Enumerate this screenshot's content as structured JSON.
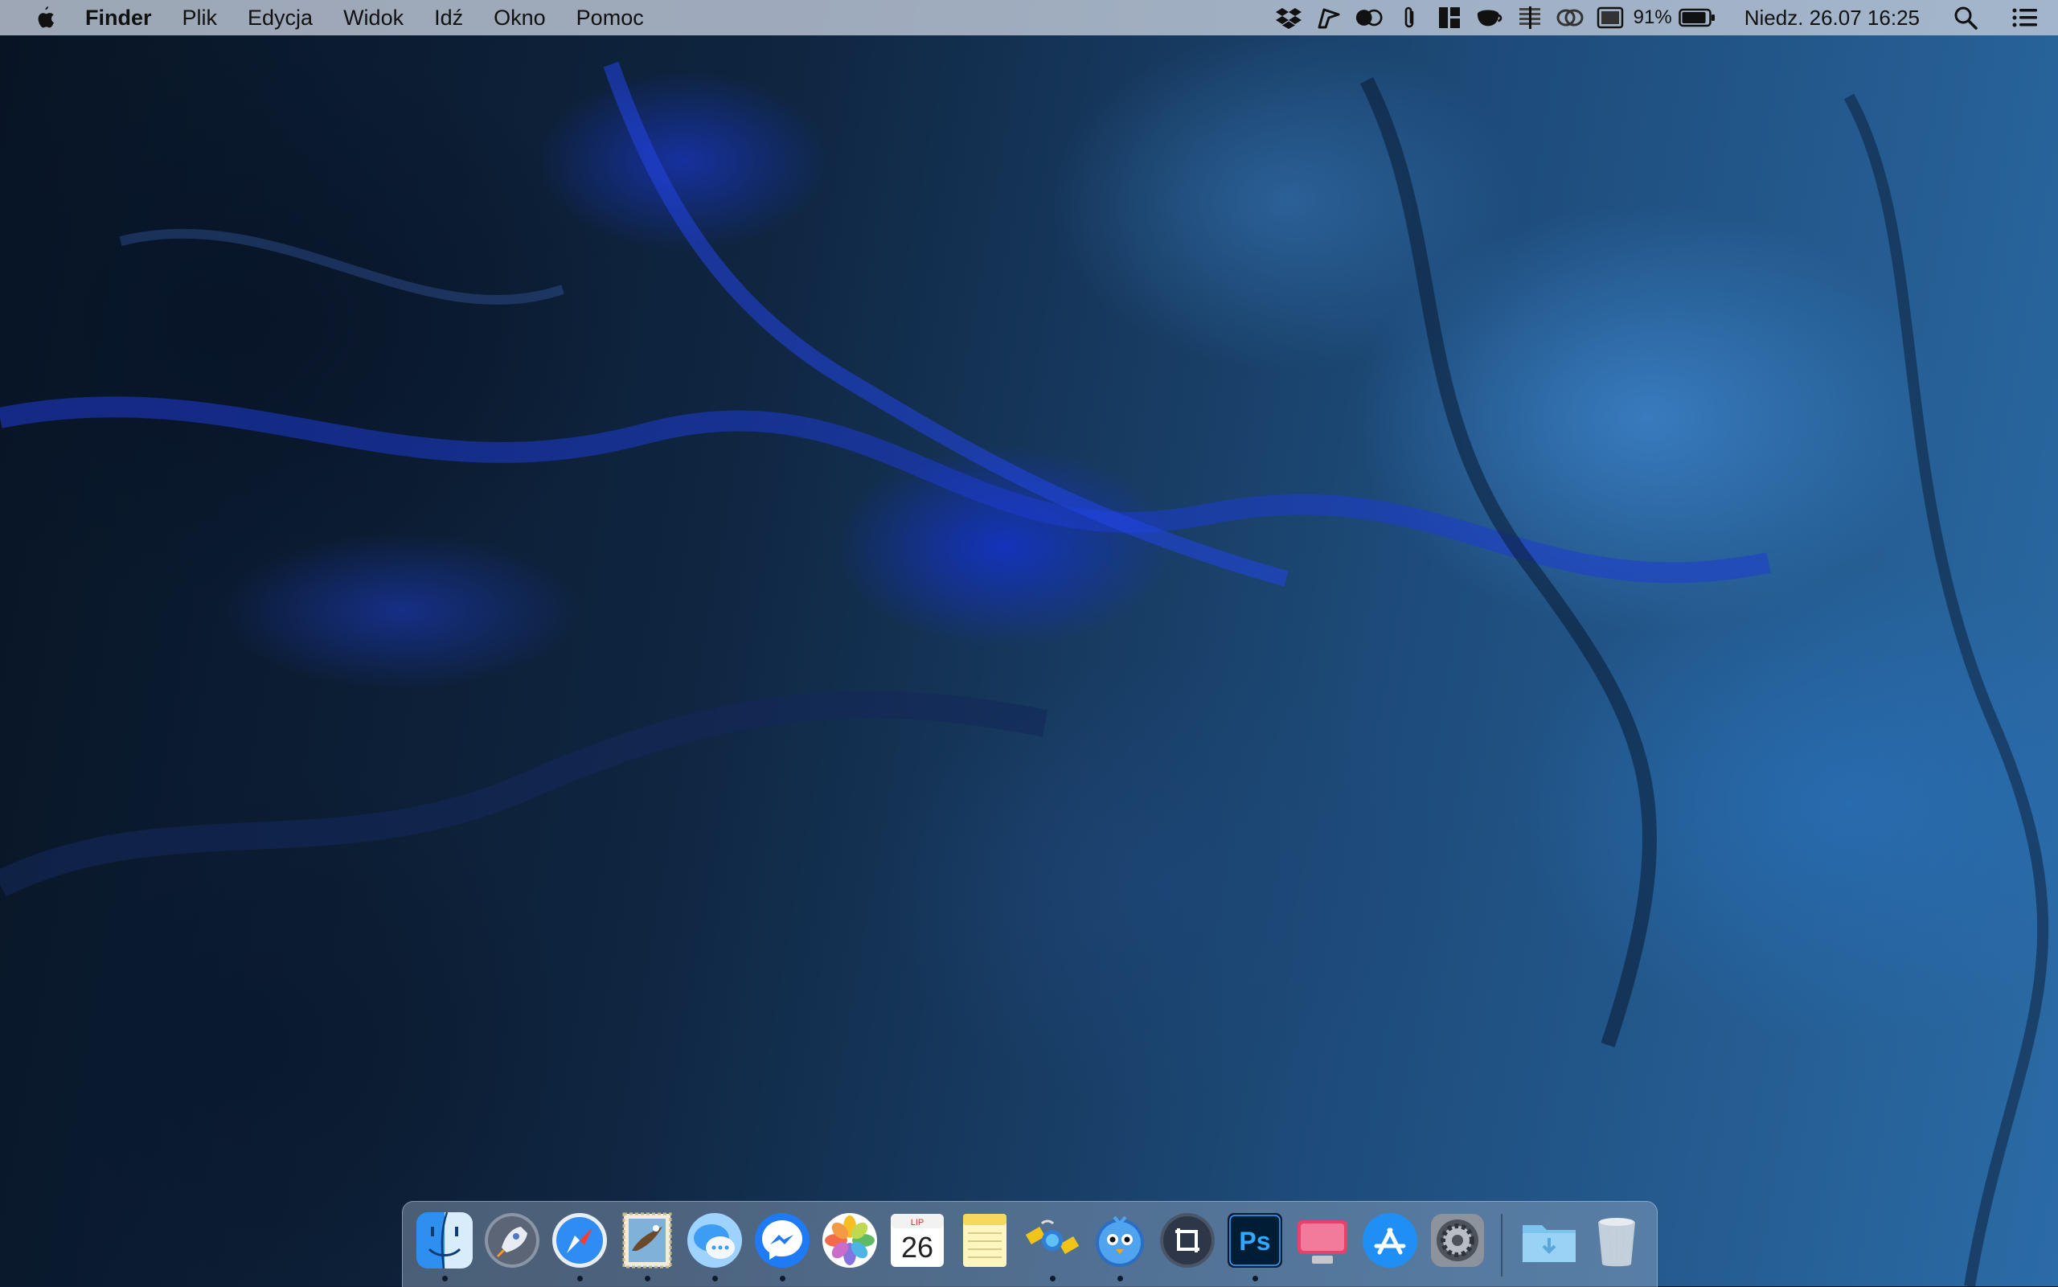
{
  "menubar": {
    "apple_icon": "apple-logo-icon",
    "items": [
      "Finder",
      "Plik",
      "Edycja",
      "Widok",
      "Idź",
      "Okno",
      "Pomoc"
    ],
    "status_icons": [
      "dropbox-icon",
      "flag-icon",
      "toggle-icon",
      "paperclip-icon",
      "layout-icon",
      "cup-icon",
      "stats-icon",
      "link-icon",
      "display-icon"
    ],
    "battery_percent": "91%",
    "battery_level": 0.91,
    "datetime": "Niedz. 26.07  16:25",
    "search_icon": "spotlight-search-icon",
    "control_icon": "notification-list-icon"
  },
  "dock": {
    "apps": [
      {
        "name": "Finder",
        "icon": "finder-icon",
        "running": true
      },
      {
        "name": "Launchpad",
        "icon": "launchpad-icon",
        "running": false
      },
      {
        "name": "Safari",
        "icon": "safari-icon",
        "running": true
      },
      {
        "name": "Mail",
        "icon": "mail-stamp-icon",
        "running": true
      },
      {
        "name": "Messages",
        "icon": "messages-icon",
        "running": true
      },
      {
        "name": "Messenger",
        "icon": "messenger-icon",
        "running": true
      },
      {
        "name": "Photos",
        "icon": "photos-icon",
        "running": false
      },
      {
        "name": "Calendar",
        "icon": "calendar-icon",
        "running": false,
        "month": "LIP",
        "day": "26"
      },
      {
        "name": "Notes",
        "icon": "notes-icon",
        "running": false
      },
      {
        "name": "Satellite",
        "icon": "satellite-icon",
        "running": true
      },
      {
        "name": "Tweetbot",
        "icon": "tweetbot-icon",
        "running": true
      },
      {
        "name": "Screen Capture",
        "icon": "crop-icon",
        "running": false
      },
      {
        "name": "Photoshop",
        "icon": "photoshop-icon",
        "running": true,
        "label": "Ps"
      },
      {
        "name": "CleanMyMac",
        "icon": "cleanmymac-icon",
        "running": false
      },
      {
        "name": "App Store",
        "icon": "appstore-icon",
        "running": false
      },
      {
        "name": "System Preferences",
        "icon": "system-preferences-icon",
        "running": false
      },
      {
        "name": "Downloads",
        "icon": "downloads-folder-icon",
        "running": false
      },
      {
        "name": "Trash",
        "icon": "trash-icon",
        "running": false
      }
    ]
  },
  "colors": {
    "menubar_bg": "#bec8d7",
    "wallpaper_dark": "#081424",
    "wallpaper_light": "#2b6ba6",
    "wallpaper_accent": "#1f3bd6"
  }
}
